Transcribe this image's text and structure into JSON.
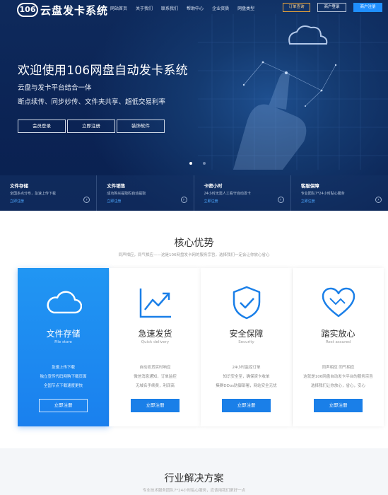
{
  "colors": {
    "hero_bg": "#0e2a5c",
    "accent_blue": "#1f8fff",
    "order_orange": "#e8a33a",
    "card_blue": "#2196f3"
  },
  "logo": {
    "badge": "106",
    "text": "云盘发卡系统"
  },
  "nav": {
    "links": [
      "网站首页",
      "关于我们",
      "联系我们",
      "帮助中心",
      "企业资质",
      "网盘类型"
    ]
  },
  "header_buttons": {
    "order_query": "订单查询",
    "merchant_login": "商户登录",
    "merchant_register": "商户注册"
  },
  "hero": {
    "title": "欢迎使用106网盘自动发卡系统",
    "subtitle1": "云盘与发卡平台结合一体",
    "subtitle2": "断点续传、同步妙传、文件夹共享、超低交易利率",
    "buttons": [
      "会员登录",
      "立即注册",
      "装饰软件"
    ]
  },
  "feature_strip": [
    {
      "title": "文件存储",
      "desc": "全国多点分布，急速上传下载",
      "link": "立即注册"
    },
    {
      "title": "文件销售",
      "desc": "成功购买提取码自动提取",
      "link": "立即注册"
    },
    {
      "title": "卡密小时",
      "desc": "24小时无需人工看守自动发卡",
      "link": "立即注册"
    },
    {
      "title": "客服保障",
      "desc": "专业团队7*24小时贴心服务",
      "link": "立即注册"
    }
  ],
  "core": {
    "title": "核心优势",
    "subtitle": "同声相应，同气相应——这是106网盘发卡网的服务宗旨，选择我们一定会让你放心省心",
    "cards": [
      {
        "icon": "cloud-icon",
        "title": "文件存储",
        "en": "File store",
        "lines": [
          "急速上传下载",
          "独立宣传代码网购下载页面",
          "全国节点下载速度更快"
        ],
        "button": "立即注册"
      },
      {
        "icon": "chart-icon",
        "title": "急速发货",
        "en": "Quick delivery",
        "lines": [
          "自动发货实时响应",
          "微信消息通知，订单监控",
          "无域名手续费，利润高"
        ],
        "button": "立即注册"
      },
      {
        "icon": "shield-icon",
        "title": "安全保障",
        "en": "Security",
        "lines": [
          "24小时监控订单",
          "知识安全至，确保资卡收单",
          "集群DDos防御部署，网站安全无忧"
        ],
        "button": "立即注册"
      },
      {
        "icon": "heart-icon",
        "title": "踏实放心",
        "en": "Rest assured",
        "lines": [
          "同声相应 同气相应",
          "这就是106网盘自动发卡平台的服务宗旨",
          "选择我们让你放心，省心，安心"
        ],
        "button": "立即注册"
      }
    ]
  },
  "solutions": {
    "title": "行业解决方案",
    "subtitle": "专业技术服务团队7*24小时贴心服务，应该用我们更好一点"
  }
}
